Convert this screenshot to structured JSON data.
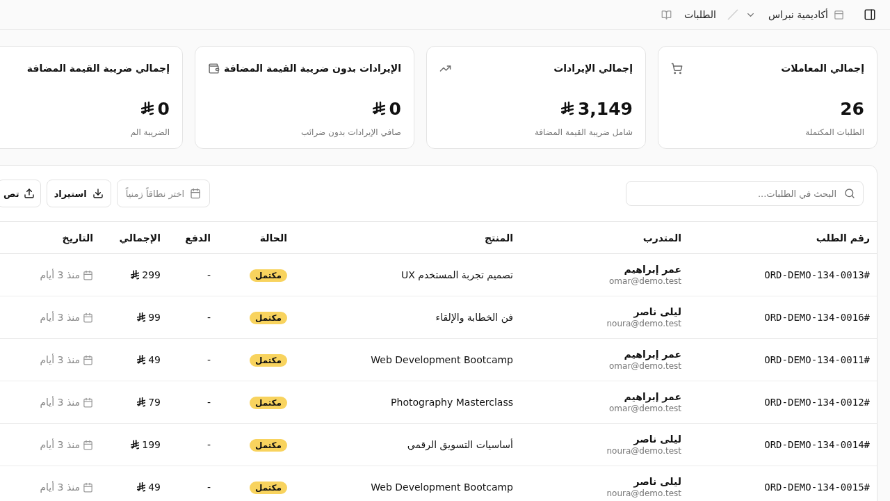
{
  "topbar": {
    "workspace": "أكاديمية نبراس",
    "page": "الطلبات"
  },
  "stats": [
    {
      "title": "إجمالي المعاملات",
      "value": "26",
      "kind": "orders",
      "subtitle": "الطلبات المكتملة"
    },
    {
      "title": "إجمالي الإيرادات",
      "value": "3,149",
      "kind": "revenue",
      "subtitle": "شامل ضريبة القيمة المضافة"
    },
    {
      "title": "الإيرادات بدون ضريبة القيمة المضافة",
      "value": "0",
      "kind": "net",
      "subtitle": "صافي الإيرادات بدون ضرائب"
    },
    {
      "title": "إجمالي ضريبة القيمة المضافة",
      "value": "0",
      "kind": "vat",
      "subtitle": "الضريبة الم"
    }
  ],
  "toolbar": {
    "search": {
      "placeholder": "البحث في الطلبات..."
    },
    "date_range": {
      "placeholder": "اختر نطاقاً زمنياً"
    },
    "buttons": [
      {
        "label": "استيراد",
        "kind": "import"
      },
      {
        "label": "تص",
        "kind": "export"
      }
    ]
  },
  "table": {
    "columns": [
      "رقم الطلب",
      "المتدرب",
      "المنتج",
      "الحالة",
      "الدفع",
      "الإجمالي",
      "التاريخ"
    ],
    "rows": [
      {
        "order": "#ORD-DEMO-134-0013",
        "trainee": "عمر إبراهيم",
        "email": "omar@demo.test",
        "product": "تصميم تجربة المستخدم UX",
        "status": "مكتمل",
        "payment": "-",
        "total": "299",
        "date": "منذ 3 أيام"
      },
      {
        "order": "#ORD-DEMO-134-0016",
        "trainee": "ليلى ناصر",
        "email": "noura@demo.test",
        "product": "فن الخطابة والإلقاء",
        "status": "مكتمل",
        "payment": "-",
        "total": "99",
        "date": "منذ 3 أيام"
      },
      {
        "order": "#ORD-DEMO-134-0011",
        "trainee": "عمر إبراهيم",
        "email": "omar@demo.test",
        "product": "Web Development Bootcamp",
        "status": "مكتمل",
        "payment": "-",
        "total": "49",
        "date": "منذ 3 أيام"
      },
      {
        "order": "#ORD-DEMO-134-0012",
        "trainee": "عمر إبراهيم",
        "email": "omar@demo.test",
        "product": "Photography Masterclass",
        "status": "مكتمل",
        "payment": "-",
        "total": "79",
        "date": "منذ 3 أيام"
      },
      {
        "order": "#ORD-DEMO-134-0014",
        "trainee": "ليلى ناصر",
        "email": "noura@demo.test",
        "product": "أساسيات التسويق الرقمي",
        "status": "مكتمل",
        "payment": "-",
        "total": "199",
        "date": "منذ 3 أيام"
      },
      {
        "order": "#ORD-DEMO-134-0015",
        "trainee": "ليلى ناصر",
        "email": "noura@demo.test",
        "product": "Web Development Bootcamp",
        "status": "مكتمل",
        "payment": "-",
        "total": "49",
        "date": "منذ 3 أيام"
      }
    ]
  }
}
